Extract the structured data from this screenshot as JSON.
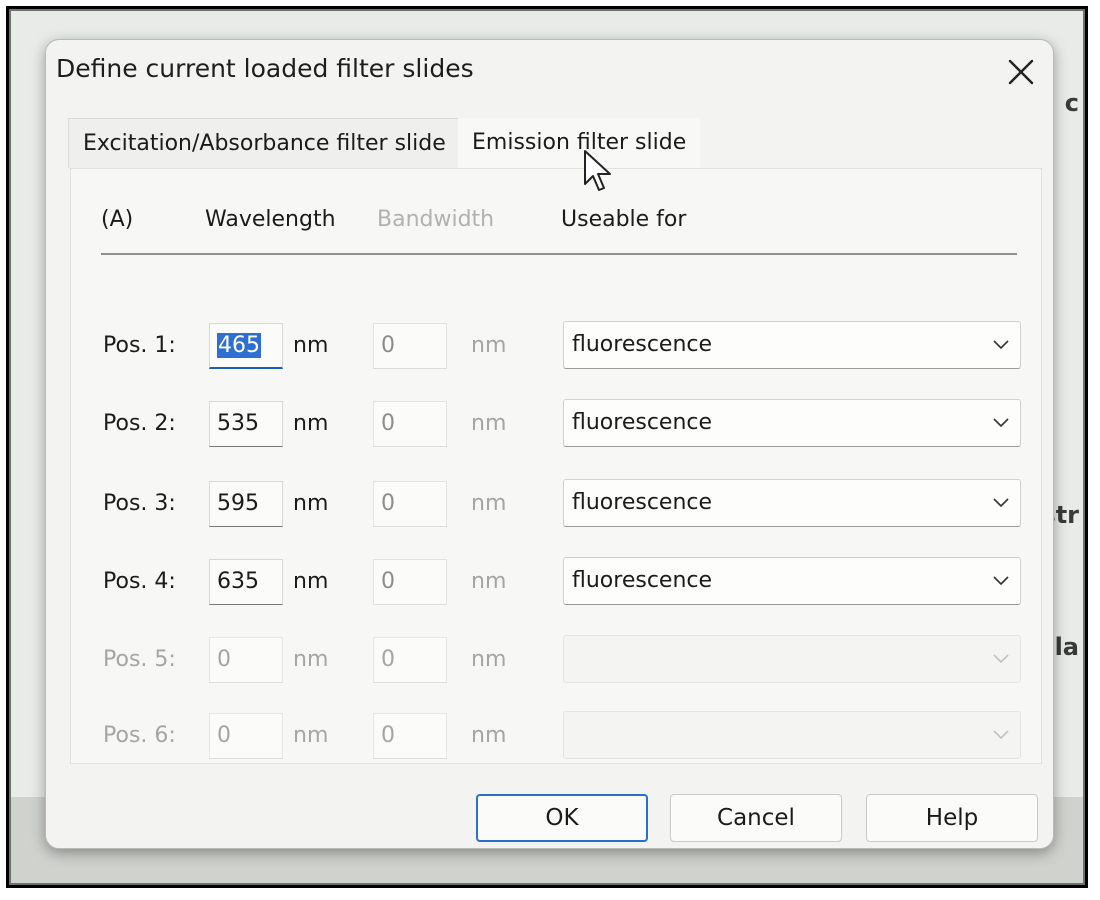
{
  "dialog": {
    "title": "Define current loaded filter slides",
    "close_icon": "close-icon"
  },
  "tabs": [
    {
      "label": "Excitation/Absorbance filter slide",
      "active": false
    },
    {
      "label": "Emission filter slide",
      "active": true
    }
  ],
  "table": {
    "header_a": "(A)",
    "header_wavelength": "Wavelength",
    "header_bandwidth": "Bandwidth",
    "header_useable": "Useable for",
    "unit": "nm",
    "rows": [
      {
        "label": "Pos. 1:",
        "wavelength": "465",
        "bandwidth": "0",
        "useable": "fluorescence",
        "enabled": true,
        "focused": true
      },
      {
        "label": "Pos. 2:",
        "wavelength": "535",
        "bandwidth": "0",
        "useable": "fluorescence",
        "enabled": true
      },
      {
        "label": "Pos. 3:",
        "wavelength": "595",
        "bandwidth": "0",
        "useable": "fluorescence",
        "enabled": true
      },
      {
        "label": "Pos. 4:",
        "wavelength": "635",
        "bandwidth": "0",
        "useable": "fluorescence",
        "enabled": true
      },
      {
        "label": "Pos. 5:",
        "wavelength": "0",
        "bandwidth": "0",
        "useable": "",
        "enabled": false
      },
      {
        "label": "Pos. 6:",
        "wavelength": "0",
        "bandwidth": "0",
        "useable": "",
        "enabled": false
      }
    ]
  },
  "buttons": {
    "ok": "OK",
    "cancel": "Cancel",
    "help": "Help"
  },
  "background_fragments": [
    "c",
    "str",
    "lla"
  ],
  "colors": {
    "focus_blue": "#2a6fc9",
    "selection_blue": "#2f6fd1"
  }
}
